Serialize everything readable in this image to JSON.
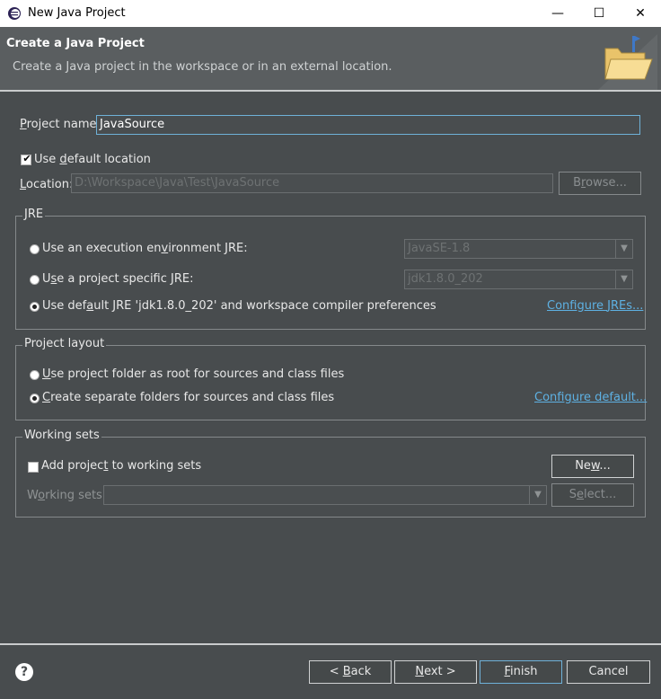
{
  "window": {
    "title": "New Java Project",
    "controls": {
      "minimize": "—",
      "maximize": "☐",
      "close": "✕"
    }
  },
  "header": {
    "title": "Create a Java Project",
    "description": "Create a Java project in the workspace or in an external location.",
    "icon": "folder-wizard-icon"
  },
  "project": {
    "name_label_prefix": "",
    "name_label_mnemonic": "P",
    "name_label_rest": "roject name:",
    "name_value": "JavaSource"
  },
  "location": {
    "use_default_pre": "Use ",
    "use_default_mnemonic": "d",
    "use_default_post": "efault location",
    "use_default_checked": true,
    "label_pre": "",
    "label_mnemonic": "L",
    "label_post": "ocation:",
    "path": "D:\\Workspace\\Java\\Test\\JavaSource",
    "browse_pre": "B",
    "browse_mnemonic": "r",
    "browse_post": "owse..."
  },
  "jre": {
    "group_label": "JRE",
    "exec_env_pre": "Use an execution en",
    "exec_env_mnemonic": "v",
    "exec_env_post": "ironment JRE:",
    "exec_env_value": "JavaSE-1.8",
    "specific_pre": "U",
    "specific_mnemonic": "s",
    "specific_post": "e a project specific JRE:",
    "specific_value": "jdk1.8.0_202",
    "default_pre": "Use def",
    "default_mnemonic": "a",
    "default_post": "ult JRE 'jdk1.8.0_202' and workspace compiler preferences",
    "configure_link_pre": "Configure ",
    "configure_link_mnemonic": "J",
    "configure_link_post": "REs...",
    "selected": "default"
  },
  "layout": {
    "group_label": "Project layout",
    "root_pre": "",
    "root_mnemonic": "U",
    "root_post": "se project folder as root for sources and class files",
    "separate_pre": "",
    "separate_mnemonic": "C",
    "separate_post": "reate separate folders for sources and class files",
    "configure_link_pre": "Confi",
    "configure_link_mnemonic": "g",
    "configure_link_post": "ure default...",
    "selected": "separate"
  },
  "working_sets": {
    "group_label": "Working sets",
    "add_pre": "Add projec",
    "add_mnemonic": "t",
    "add_post": " to working sets",
    "add_checked": false,
    "new_pre": "Ne",
    "new_mnemonic": "w",
    "new_post": "...",
    "label_pre": "W",
    "label_mnemonic": "o",
    "label_post": "rking sets:",
    "select_pre": "S",
    "select_mnemonic": "e",
    "select_post": "lect..."
  },
  "footer": {
    "help": "?",
    "back_pre": "< ",
    "back_mnemonic": "B",
    "back_post": "ack",
    "next_pre": "",
    "next_mnemonic": "N",
    "next_post": "ext >",
    "finish_pre": "",
    "finish_mnemonic": "F",
    "finish_post": "inish",
    "cancel": "Cancel"
  }
}
